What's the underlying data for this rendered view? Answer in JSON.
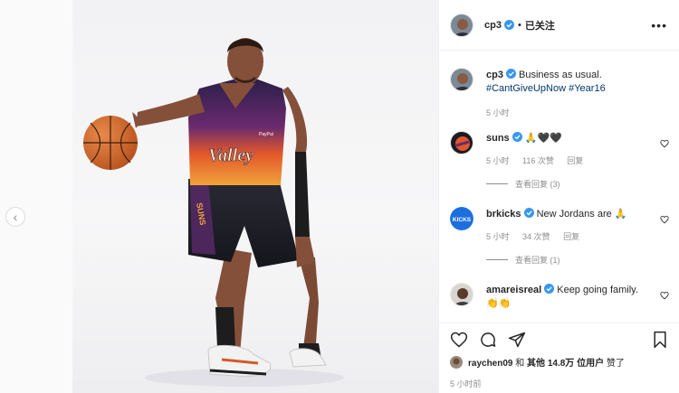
{
  "post_author": {
    "username": "cp3",
    "follow_state": "已关注",
    "separator": "•"
  },
  "caption": {
    "username": "cp3",
    "text": "Business as usual.",
    "hashtags": [
      "#CantGiveUpNow",
      "#Year16"
    ],
    "time": "5 小时"
  },
  "comments": [
    {
      "username": "suns",
      "text": "🙏🖤🖤",
      "time": "5 小时",
      "likes": "116 次赞",
      "reply": "回复",
      "view_replies": "查看回复 (3)"
    },
    {
      "username": "brkicks",
      "text": "New Jordans are 🙏",
      "time": "5 小时",
      "likes": "34 次赞",
      "reply": "回复",
      "view_replies": "查看回复 (1)",
      "avatar_text": "KICKS"
    },
    {
      "username": "amareisreal",
      "text": "Keep going family.",
      "text2": "👏👏"
    }
  ],
  "likes": {
    "liker": "raychen09",
    "mid": " 和 ",
    "others": "其他 14.8万 位用户",
    "end": " 赞了"
  },
  "posted_time": "5 小时前",
  "photo": {
    "jersey_text": "Valley",
    "shorts_text": "SUNS",
    "sponsor": "PayPal"
  },
  "colors": {
    "verified": "#3897f0",
    "hashtag": "#00376b",
    "muted": "#8e8e8e",
    "brkicks": "#1d6fe0"
  },
  "icons": {
    "carousel_prev": "chevron-left-icon",
    "more": "more-icon",
    "like": "heart-icon",
    "comment": "comment-icon",
    "share": "share-icon",
    "save": "bookmark-icon"
  }
}
